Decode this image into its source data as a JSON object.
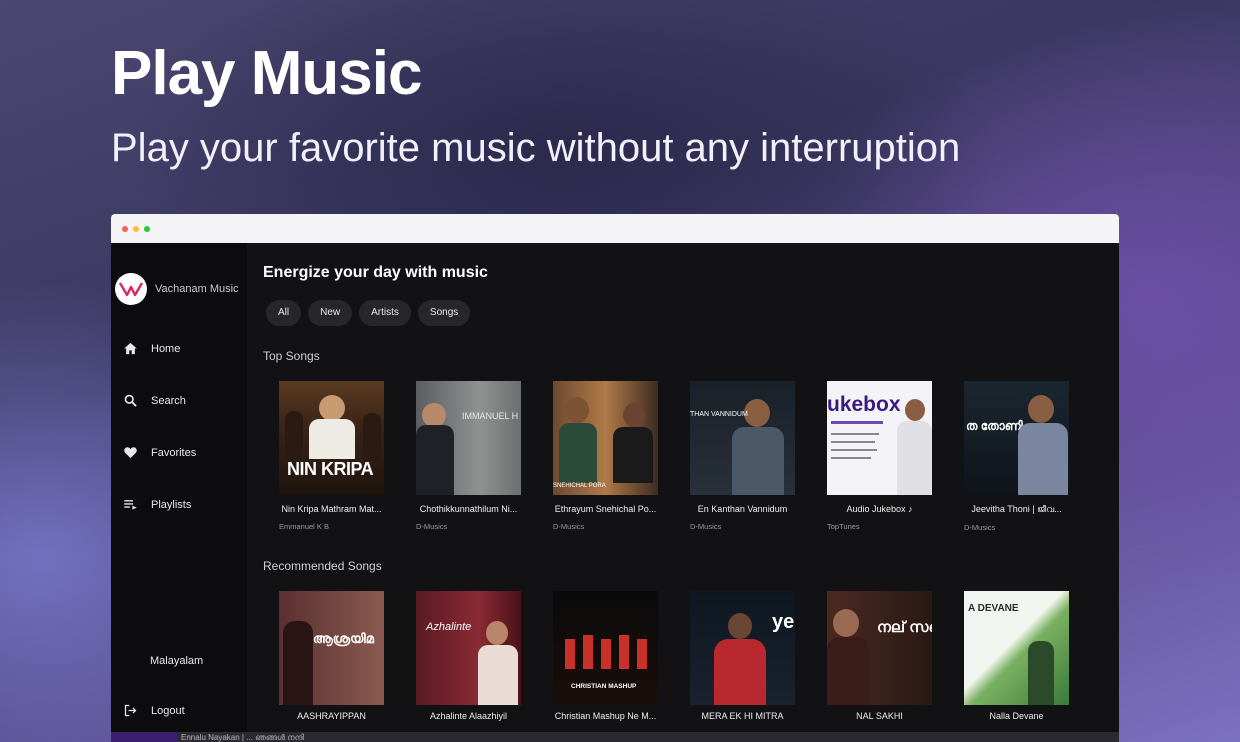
{
  "hero": {
    "title": "Play Music",
    "subtitle": "Play your favorite music without any interruption"
  },
  "sidebar": {
    "brand": "Vachanam Music",
    "logo_text": "VM",
    "items": [
      {
        "label": "Home",
        "icon": "home-icon"
      },
      {
        "label": "Search",
        "icon": "search-icon"
      },
      {
        "label": "Favorites",
        "icon": "heart-icon"
      },
      {
        "label": "Playlists",
        "icon": "playlist-icon"
      }
    ],
    "language": "Malayalam",
    "logout": "Logout"
  },
  "main": {
    "heading": "Energize your day with music",
    "chips": [
      "All",
      "New",
      "Artists",
      "Songs"
    ],
    "top_songs_title": "Top Songs",
    "recommended_title": "Recommended Songs",
    "top_songs": [
      {
        "title": "Nin Kripa Mathram Mat...",
        "artist": "Emmanuel K B",
        "thumb_text": "NIN KRIPA"
      },
      {
        "title": "Chothikkunnathilum Ni...",
        "artist": "D-Musics",
        "thumb_text": "IMMANUEL H"
      },
      {
        "title": "Ethrayum Snehichal Po...",
        "artist": "D-Musics",
        "thumb_text": "SNEHICHAL PORA"
      },
      {
        "title": "En Kanthan Vannidum",
        "artist": "D-Musics",
        "thumb_text": "THAN VANNIDUM"
      },
      {
        "title": "Audio Jukebox ♪",
        "artist": "TopTunes",
        "thumb_text": "ukebox"
      },
      {
        "title": "Jeevitha Thoni | ജീവ...",
        "artist": "D-Musics",
        "thumb_text": "ത തോണി"
      }
    ],
    "recommended": [
      {
        "title": "AASHRAYIPPAN",
        "thumb_text": "ആശ്രയിമ"
      },
      {
        "title": "Azhalinte Alaazhiyil",
        "thumb_text": "Azhalinte"
      },
      {
        "title": "Christian Mashup Ne M...",
        "thumb_text": "CHRISTIAN MASHUP"
      },
      {
        "title": "MERA EK HI MITRA",
        "thumb_text": "yes"
      },
      {
        "title": "NAL SAKHI",
        "thumb_text": "നല് സഖി"
      },
      {
        "title": "Nalla Devane",
        "thumb_text": "A DEVANE"
      }
    ]
  },
  "player": {
    "now_playing": "Ennalu Nayakan | ... ഞങ്ങൾ നന്ദി"
  },
  "colors": {
    "accent": "#3b1e6e",
    "background": "#121214",
    "sidebar": "#0c0c0e"
  }
}
